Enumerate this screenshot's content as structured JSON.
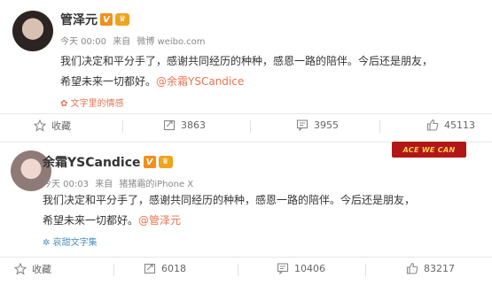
{
  "posts": [
    {
      "author": "管泽元",
      "v_badge": "V",
      "crown_badge": "♛",
      "time": "今天 00:00",
      "source_prefix": "来自",
      "source": "微博 weibo.com",
      "text_line1": "我们决定和平分手了，感谢共同经历的种种，感恩一路的陪伴。今后还是朋友，",
      "text_line2": "希望未来一切都好。",
      "mention": "@余霜YSCandice",
      "sublink": "文字里的情感",
      "actions": {
        "favorite": "收藏",
        "repost": "3863",
        "comment": "3955",
        "like": "45113"
      }
    },
    {
      "author": "余霜YSCandice",
      "v_badge": "V",
      "crown_badge": "♛",
      "time": "今天 00:03",
      "source_prefix": "来自",
      "source": "猪猪霜的iPhone X",
      "text_line1": "我们决定和平分手了，感谢共同经历的种种，感恩一路的陪伴。今后还是朋友，",
      "text_line2": "希望未来一切都好。",
      "mention": "@管泽元",
      "sublink": "哀甜文字集",
      "promo": "ACE WE CAN",
      "actions": {
        "favorite": "收藏",
        "repost": "6018",
        "comment": "10406",
        "like": "83217"
      }
    }
  ]
}
